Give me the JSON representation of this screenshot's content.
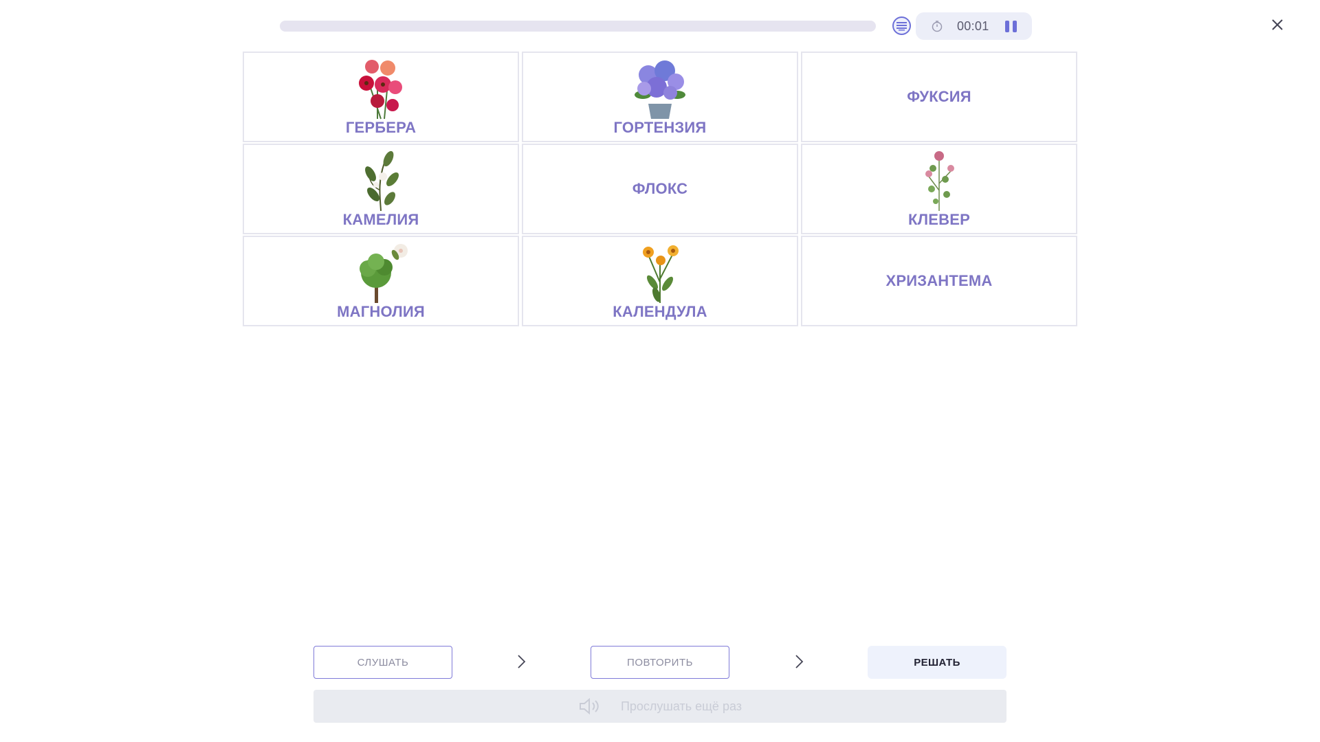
{
  "header": {
    "progress": 0,
    "timer": "00:01",
    "icons": {
      "list": "list-icon",
      "clock": "clock-icon",
      "pause": "pause-icon",
      "close": "close-icon"
    }
  },
  "cards": [
    {
      "label": "ГЕРБЕРА",
      "has_image": true,
      "image": "gerbera-image"
    },
    {
      "label": "ГОРТЕНЗИЯ",
      "has_image": true,
      "image": "hydrangea-image"
    },
    {
      "label": "ФУКСИЯ",
      "has_image": false
    },
    {
      "label": "КАМЕЛИЯ",
      "has_image": true,
      "image": "camellia-image"
    },
    {
      "label": "ФЛОКС",
      "has_image": false
    },
    {
      "label": "КЛЕВЕР",
      "has_image": true,
      "image": "clover-image"
    },
    {
      "label": "МАГНОЛИЯ",
      "has_image": true,
      "image": "magnolia-image"
    },
    {
      "label": "КАЛЕНДУЛА",
      "has_image": true,
      "image": "calendula-image"
    },
    {
      "label": "ХРИЗАНТЕМА",
      "has_image": false
    }
  ],
  "steps": {
    "listen": "СЛУШАТЬ",
    "repeat": "ПОВТОРИТЬ",
    "solve": "РЕШАТЬ"
  },
  "listen_again": "Прослушать ещё раз",
  "colors": {
    "accent": "#6c6fd8",
    "label": "#7e75c4",
    "card_border": "#e5e5ee"
  }
}
